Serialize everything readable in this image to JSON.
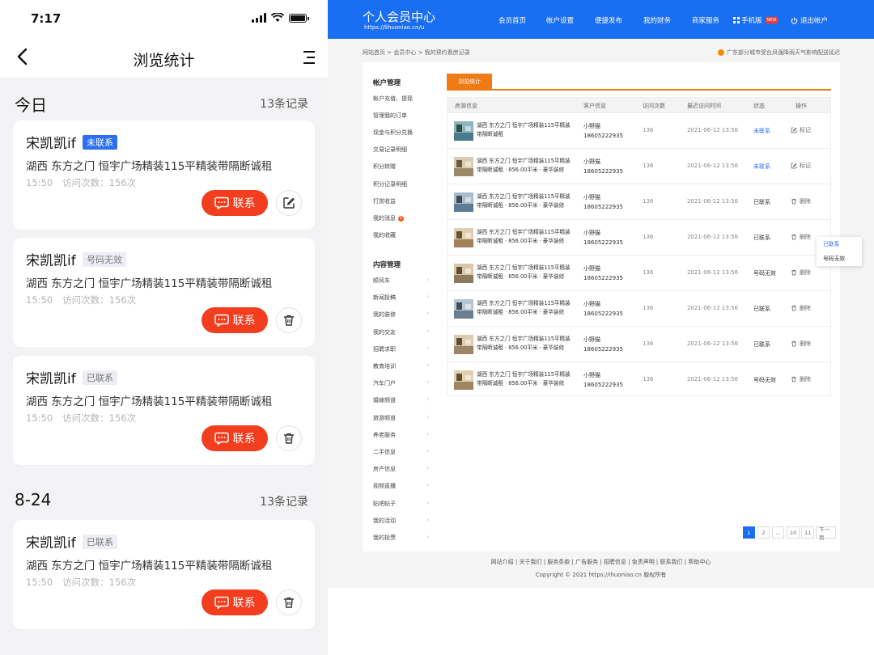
{
  "mobile": {
    "status_time": "7:17",
    "title": "浏览统计",
    "sections": [
      {
        "date": "今日",
        "count": "13条记录"
      },
      {
        "date": "8-24",
        "count": "13条记录"
      }
    ],
    "cards": [
      {
        "name": "宋凯凯if",
        "badge": "未联系",
        "title": "湖西 东方之门 恒宇广场精装115平精装带隔断诚租",
        "time": "15:50",
        "visits": "访问次数：156次",
        "contact": "联系",
        "action": "edit-icon"
      },
      {
        "name": "宋凯凯if",
        "badge": "号码无效",
        "title": "湖西 东方之门 恒宇广场精装115平精装带隔断诚租",
        "time": "15:50",
        "visits": "访问次数：156次",
        "contact": "联系",
        "action": "trash-icon"
      },
      {
        "name": "宋凯凯if",
        "badge": "已联系",
        "title": "湖西 东方之门 恒宇广场精装115平精装带隔断诚租",
        "time": "15:50",
        "visits": "访问次数：156次",
        "contact": "联系",
        "action": "trash-icon"
      },
      {
        "name": "宋凯凯if",
        "badge": "已联系",
        "title": "湖西 东方之门 恒宇广场精装115平精装带隔断诚租",
        "time": "15:50",
        "visits": "访问次数：156次",
        "contact": "联系",
        "action": "trash-icon"
      }
    ]
  },
  "desktop": {
    "logo": "个人会员中心",
    "logo_url": "https://lihuoniao.cn/u",
    "nav": [
      "会员首页",
      "帐户设置",
      "便捷发布",
      "我的财务",
      "商家服务",
      "手机版",
      "退出帐户"
    ],
    "nav_new": "NEW",
    "breadcrumb": "网站首页  >  会员中心  >  我的预约看房记录",
    "notice": "广东部分城市受台风强降雨天气影响配送延迟",
    "sidebar": {
      "account_header": "帐户管理",
      "account_items": [
        "帐户充值、提现",
        "管理我的订单",
        "现金与积分兑换",
        "交易记录明细",
        "积分转赠",
        "积分记录明细",
        "打赏收益",
        "我的消息",
        "我的收藏"
      ],
      "msg_count": "1",
      "content_header": "内容管理",
      "content_items": [
        "顺风车",
        "新闻投稿",
        "我的装修",
        "我的交友",
        "招聘求职",
        "教育培训",
        "汽车门户",
        "婚嫁频道",
        "旅游频道",
        "养老服务",
        "二手信息",
        "房产信息",
        "视频直播",
        "贴吧帖子",
        "我的活动",
        "我的投票"
      ]
    },
    "tab": "浏览统计",
    "table": {
      "headers": [
        "房源信息",
        "客户信息",
        "访问次数",
        "最近访问时间",
        "状态",
        "操作"
      ],
      "rows": [
        {
          "title": "湖西 东方之门 恒宇广场精装115平精装带隔断诚租",
          "customer": "小野猫",
          "phone": "18605222935",
          "visits": "136",
          "time": "2021-06-12 13:56",
          "status": "未联系",
          "action": "标记"
        },
        {
          "title": "湖西 东方之门 恒宇广场精装115平精装带隔断诚租 · 856.00平米 · 豪华装修",
          "customer": "小野猫",
          "phone": "18605222935",
          "visits": "136",
          "time": "2021-06-12 13:56",
          "status": "未联系",
          "action": "标记"
        },
        {
          "title": "湖西 东方之门 恒宇广场精装115平精装带隔断诚租 · 856.00平米 · 豪华装修",
          "customer": "小野猫",
          "phone": "18605222935",
          "visits": "136",
          "time": "2021-06-12 13:56",
          "status": "已联系",
          "action": "删除"
        },
        {
          "title": "湖西 东方之门 恒宇广场精装115平精装带隔断诚租 · 856.00平米 · 豪华装修",
          "customer": "小野猫",
          "phone": "18605222935",
          "visits": "136",
          "time": "2021-06-12 13:56",
          "status": "已联系",
          "action": "删除"
        },
        {
          "title": "湖西 东方之门 恒宇广场精装115平精装带隔断诚租 · 856.00平米 · 豪华装修",
          "customer": "小野猫",
          "phone": "18605222935",
          "visits": "136",
          "time": "2021-06-12 13:56",
          "status": "号码无效",
          "action": "删除"
        },
        {
          "title": "湖西 东方之门 恒宇广场精装115平精装带隔断诚租 · 856.00平米 · 豪华装修",
          "customer": "小野猫",
          "phone": "18605222935",
          "visits": "136",
          "time": "2021-06-12 13:56",
          "status": "已联系",
          "action": "删除"
        },
        {
          "title": "湖西 东方之门 恒宇广场精装115平精装带隔断诚租 · 856.00平米 · 豪华装修",
          "customer": "小野猫",
          "phone": "18605222935",
          "visits": "136",
          "time": "2021-06-12 13:56",
          "status": "已联系",
          "action": "删除"
        },
        {
          "title": "湖西 东方之门 恒宇广场精装115平精装带隔断诚租 · 856.00平米 · 豪华装修",
          "customer": "小野猫",
          "phone": "18605222935",
          "visits": "136",
          "time": "2021-06-12 13:56",
          "status": "号码无效",
          "action": "删除"
        }
      ]
    },
    "status_menu": [
      "已联系",
      "号码无效"
    ],
    "pagination": [
      "1",
      "2",
      "...",
      "10",
      "11",
      "下一页"
    ],
    "footer_links": "网站介绍 | 关于我们 | 服务条款 | 广告服务 | 招聘信息 | 免责声明 | 联系我们 | 帮助中心",
    "copyright": "Copyright © 2021 https://ihuoniao.cn 版权所有",
    "colors": {
      "primary": "#1a6ef2",
      "accent": "#f07a14",
      "contact_btn": "#f23d1f",
      "status_blue": "#2d6ff2"
    }
  }
}
